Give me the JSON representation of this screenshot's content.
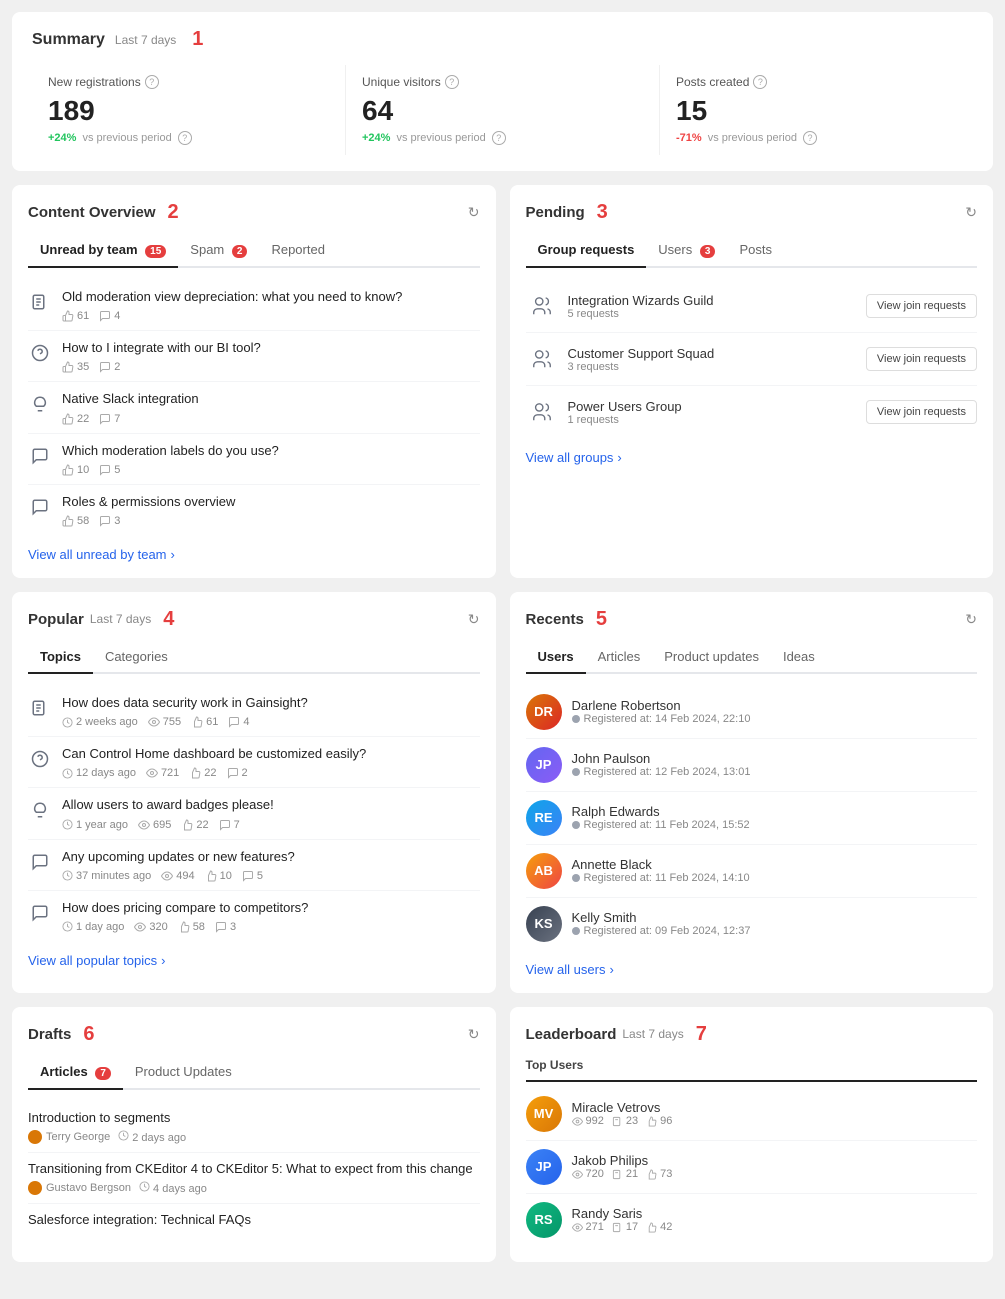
{
  "summary": {
    "title": "Summary",
    "period": "Last 7 days",
    "stats": [
      {
        "label": "New registrations",
        "value": "189",
        "change": "+24%",
        "change_type": "positive",
        "vs_label": "vs previous period"
      },
      {
        "label": "Unique visitors",
        "value": "64",
        "change": "+24%",
        "change_type": "positive",
        "vs_label": "vs previous period"
      },
      {
        "label": "Posts created",
        "value": "15",
        "change": "-71%",
        "change_type": "negative",
        "vs_label": "vs previous period"
      }
    ]
  },
  "content_overview": {
    "title": "Content Overview",
    "tabs": [
      {
        "label": "Unread by team",
        "badge": "15",
        "badge_type": "red"
      },
      {
        "label": "Spam",
        "badge": "2",
        "badge_type": "red"
      },
      {
        "label": "Reported",
        "badge": null
      }
    ],
    "items": [
      {
        "icon": "document",
        "title": "Old moderation view depreciation: what you need to know?",
        "likes": "61",
        "comments": "4"
      },
      {
        "icon": "question",
        "title": "How to I integrate with our BI tool?",
        "likes": "35",
        "comments": "2"
      },
      {
        "icon": "lightbulb",
        "title": "Native Slack integration",
        "likes": "22",
        "comments": "7"
      },
      {
        "icon": "chat",
        "title": "Which moderation labels do you use?",
        "likes": "10",
        "comments": "5"
      },
      {
        "icon": "chat",
        "title": "Roles & permissions overview",
        "likes": "58",
        "comments": "3"
      }
    ],
    "view_all_label": "View all unread by team"
  },
  "pending": {
    "title": "Pending",
    "tabs": [
      {
        "label": "Group requests",
        "badge": null
      },
      {
        "label": "Users",
        "badge": "3",
        "badge_type": "red"
      },
      {
        "label": "Posts",
        "badge": null
      }
    ],
    "items": [
      {
        "name": "Integration Wizards Guild",
        "requests": "5 requests",
        "button": "View join requests"
      },
      {
        "name": "Customer Support Squad",
        "requests": "3 requests",
        "button": "View join requests"
      },
      {
        "name": "Power Users Group",
        "requests": "1 requests",
        "button": "View join requests"
      }
    ],
    "view_all_label": "View all groups"
  },
  "popular": {
    "title": "Popular",
    "period": "Last 7 days",
    "tabs": [
      {
        "label": "Topics"
      },
      {
        "label": "Categories"
      }
    ],
    "items": [
      {
        "icon": "document",
        "title": "How does data security work in Gainsight?",
        "time": "2 weeks ago",
        "views": "755",
        "likes": "61",
        "comments": "4"
      },
      {
        "icon": "question",
        "title": "Can Control Home dashboard be customized easily?",
        "time": "12 days ago",
        "views": "721",
        "likes": "22",
        "comments": "2"
      },
      {
        "icon": "lightbulb",
        "title": "Allow users to award badges please!",
        "time": "1 year ago",
        "views": "695",
        "likes": "22",
        "comments": "7"
      },
      {
        "icon": "chat",
        "title": "Any upcoming updates or new features?",
        "time": "37 minutes ago",
        "views": "494",
        "likes": "10",
        "comments": "5"
      },
      {
        "icon": "chat",
        "title": "How does pricing compare to competitors?",
        "time": "1 day ago",
        "views": "320",
        "likes": "58",
        "comments": "3"
      }
    ],
    "view_all_label": "View all popular topics"
  },
  "recents": {
    "title": "Recents",
    "tabs": [
      {
        "label": "Users"
      },
      {
        "label": "Articles"
      },
      {
        "label": "Product updates"
      },
      {
        "label": "Ideas"
      }
    ],
    "users": [
      {
        "name": "Darlene Robertson",
        "date": "Registered at: 14 Feb 2024, 22:10",
        "avatar_class": "avatar-darlene",
        "initials": "DR"
      },
      {
        "name": "John Paulson",
        "date": "Registered at: 12 Feb 2024, 13:01",
        "avatar_class": "avatar-john",
        "initials": "JP"
      },
      {
        "name": "Ralph Edwards",
        "date": "Registered at: 11 Feb 2024, 15:52",
        "avatar_class": "avatar-ralph",
        "initials": "RE"
      },
      {
        "name": "Annette Black",
        "date": "Registered at: 11 Feb 2024, 14:10",
        "avatar_class": "avatar-annette",
        "initials": "AB"
      },
      {
        "name": "Kelly Smith",
        "date": "Registered at: 09 Feb 2024, 12:37",
        "avatar_class": "avatar-kelly",
        "initials": "KS"
      }
    ],
    "view_all_label": "View all users"
  },
  "drafts": {
    "title": "Drafts",
    "tabs": [
      {
        "label": "Articles",
        "badge": "7",
        "badge_type": "red"
      },
      {
        "label": "Product Updates"
      }
    ],
    "items": [
      {
        "title": "Introduction to segments",
        "author": "Terry George",
        "time": "2 days ago"
      },
      {
        "title": "Transitioning from CKEditor 4 to CKEditor 5: What to expect from this change",
        "author": "Gustavo Bergson",
        "time": "4 days ago"
      },
      {
        "title": "Salesforce integration: Technical FAQs",
        "author": "",
        "time": ""
      }
    ]
  },
  "leaderboard": {
    "title": "Leaderboard",
    "period": "Last 7 days",
    "subtitle": "Top Users",
    "users": [
      {
        "name": "Miracle Vetrovs",
        "views": "992",
        "posts": "23",
        "likes": "96",
        "avatar_class": "avatar-miracle",
        "initials": "MV"
      },
      {
        "name": "Jakob Philips",
        "views": "720",
        "posts": "21",
        "likes": "73",
        "avatar_class": "avatar-jakob",
        "initials": "JP"
      },
      {
        "name": "Randy Saris",
        "views": "271",
        "posts": "17",
        "likes": "42",
        "avatar_class": "avatar-randy",
        "initials": "RS"
      }
    ]
  },
  "icons": {
    "document": "📄",
    "question": "❓",
    "lightbulb": "💡",
    "chat": "💬",
    "refresh": "↻",
    "chevron_right": "›",
    "clock": "🕐",
    "eye": "👁",
    "thumb": "👍",
    "comment": "💬",
    "calendar": "📅",
    "group": "👥"
  }
}
